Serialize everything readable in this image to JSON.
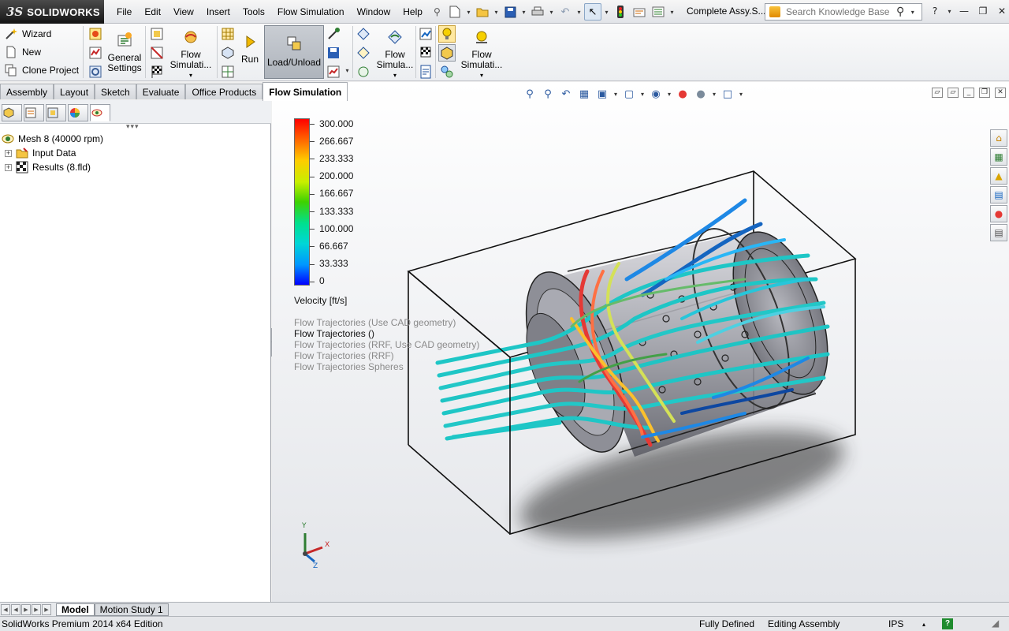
{
  "app": {
    "brand_ds": "3S",
    "brand_name": "SOLIDWORKS",
    "document_title": "Complete Assy.S..."
  },
  "menu": [
    "File",
    "Edit",
    "View",
    "Insert",
    "Tools",
    "Flow Simulation",
    "Window",
    "Help"
  ],
  "search": {
    "placeholder": "Search Knowledge Base"
  },
  "command_manager": {
    "wizard": "Wizard",
    "new": "New",
    "clone_project": "Clone Project",
    "general_settings_1": "General",
    "general_settings_2": "Settings",
    "flow_sim_1": "Flow",
    "flow_sim_1b": "Simulati...",
    "run": "Run",
    "load_unload": "Load/Unload",
    "flow_sim_2": "Flow",
    "flow_sim_2b": "Simula...",
    "flow_sim_3": "Flow",
    "flow_sim_3b": "Simulati..."
  },
  "tabs": [
    "Assembly",
    "Layout",
    "Sketch",
    "Evaluate",
    "Office Products",
    "Flow Simulation"
  ],
  "active_tab": "Flow Simulation",
  "tree": {
    "root": "Mesh 8 (40000 rpm)",
    "input_data": "Input Data",
    "results": "Results (8.fld)"
  },
  "legend": {
    "values": [
      "300.000",
      "266.667",
      "233.333",
      "200.000",
      "166.667",
      "133.333",
      "100.000",
      "66.667",
      "33.333",
      "0"
    ],
    "title": "Velocity [ft/s]",
    "colors": [
      "#ff0000",
      "#ff6a00",
      "#ffcc00",
      "#c7ef00",
      "#3ed100",
      "#00e08f",
      "#00d6d6",
      "#0096ff",
      "#0000ff"
    ]
  },
  "plots": [
    {
      "label": "Flow Trajectories (Use CAD geometry)",
      "active": false
    },
    {
      "label": "Flow Trajectories ()",
      "active": true
    },
    {
      "label": "Flow Trajectories (RRF, Use CAD geometry)",
      "active": false
    },
    {
      "label": "Flow Trajectories (RRF)",
      "active": false
    },
    {
      "label": "Flow Trajectories Spheres",
      "active": false
    }
  ],
  "triad": {
    "x": "X",
    "y": "Y",
    "z": "Z"
  },
  "bottom_tabs": [
    "Model",
    "Motion Study 1"
  ],
  "status": {
    "edition": "SolidWorks Premium 2014 x64 Edition",
    "defined": "Fully Defined",
    "mode": "Editing Assembly",
    "units": "IPS",
    "help": "?"
  }
}
